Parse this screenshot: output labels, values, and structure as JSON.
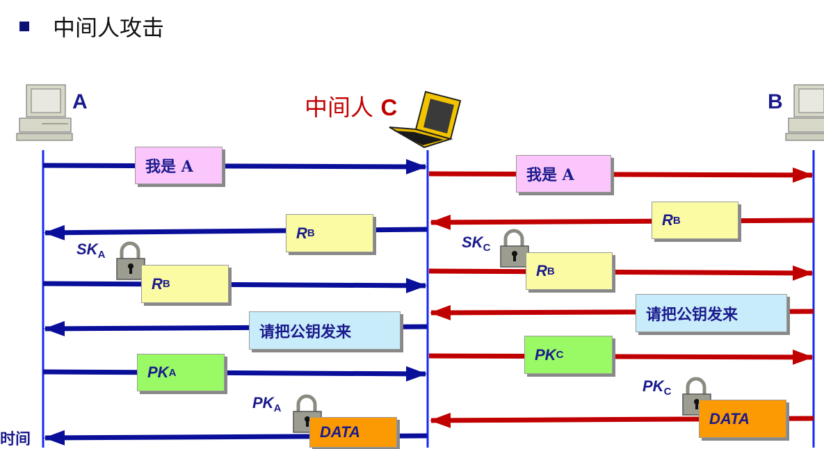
{
  "title": "中间人攻击",
  "parties": {
    "a": "A",
    "b": "B",
    "c_prefix": "中间人",
    "c_letter": "C"
  },
  "time_label": "时间",
  "messages_left": {
    "iam": "我是 A",
    "rb_main": "R",
    "rb_main_sub": "B",
    "rb_locked": "R",
    "rb_locked_sub": "B",
    "request": "请把公钥发来",
    "pk": "PK",
    "pk_sub": "A",
    "data": "DATA"
  },
  "messages_right": {
    "iam": "我是 A",
    "rb_main": "R",
    "rb_main_sub": "B",
    "rb_locked": "R",
    "rb_locked_sub": "B",
    "request": "请把公钥发来",
    "pk": "PK",
    "pk_sub": "C",
    "data": "DATA"
  },
  "keys": {
    "ska": "SK",
    "ska_sub": "A",
    "skc": "SK",
    "skc_sub": "C",
    "pka": "PK",
    "pka_sub": "A",
    "pkc": "PK",
    "pkc_sub": "C"
  },
  "colors": {
    "blue_arrow": "#0a0f9a",
    "red_arrow": "#c00000",
    "timeline": "#1428f0"
  },
  "icons": [
    "computer-icon",
    "laptop-icon",
    "padlock-icon"
  ]
}
